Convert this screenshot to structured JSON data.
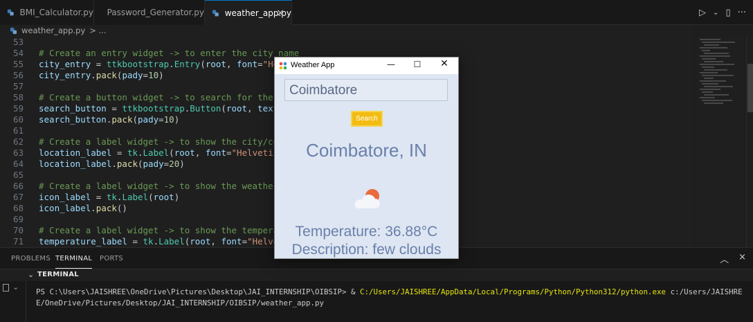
{
  "tabs": [
    {
      "label": "BMI_Calculator.py",
      "active": false
    },
    {
      "label": "Password_Generator.py",
      "active": false
    },
    {
      "label": "weather_app.py",
      "active": true
    }
  ],
  "breadcrumb": {
    "file": "weather_app.py",
    "rest": "> ..."
  },
  "editor": {
    "lines": [
      {
        "n": "53",
        "code": ""
      },
      {
        "n": "54",
        "code": "# Create an entry widget -> to enter the city name"
      },
      {
        "n": "55",
        "code": "city_entry = ttkbootstrap.Entry(root, font=\"Helvetica"
      },
      {
        "n": "56",
        "code": "city_entry.pack(pady=10)"
      },
      {
        "n": "57",
        "code": ""
      },
      {
        "n": "58",
        "code": "# Create a button widget -> to search for the weather"
      },
      {
        "n": "59",
        "code": "search_button = ttkbootstrap.Button(root, text=\"Searc"
      },
      {
        "n": "60",
        "code": "search_button.pack(pady=10)"
      },
      {
        "n": "61",
        "code": ""
      },
      {
        "n": "62",
        "code": "# Create a label widget -> to show the city/country n"
      },
      {
        "n": "63",
        "code": "location_label = tk.Label(root, font=\"Helvetica, 25\")"
      },
      {
        "n": "64",
        "code": "location_label.pack(pady=20)"
      },
      {
        "n": "65",
        "code": ""
      },
      {
        "n": "66",
        "code": "# Create a label widget -> to show the weather icon"
      },
      {
        "n": "67",
        "code": "icon_label = tk.Label(root)"
      },
      {
        "n": "68",
        "code": "icon_label.pack()"
      },
      {
        "n": "69",
        "code": ""
      },
      {
        "n": "70",
        "code": "# Create a label widget -> to show the temperature"
      },
      {
        "n": "71",
        "code": "temperature_label = tk.Label(root, font=\"Helvetica, 2"
      }
    ]
  },
  "panel": {
    "tabs": [
      "PROBLEMS",
      "TERMINAL",
      "PORTS"
    ],
    "terminal_title": "TERMINAL",
    "prompt": "PS C:\\Users\\JAISHREE\\OneDrive\\Pictures\\Desktop\\JAI_INTERNSHIP\\OIBSIP> & ",
    "exe": "C:/Users/JAISHREE/AppData/Local/Programs/Python/Python312/python.exe",
    "args": " c:/Users/JAISHREE/OneDrive/Pictures/Desktop/JAI_INTERNSHIP/OIBSIP/weather_app.py"
  },
  "weather_window": {
    "title": "Weather App",
    "city_value": "Coimbatore",
    "search_label": "Search",
    "location": "Coimbatore, IN",
    "icon": "few-clouds-icon",
    "temperature": "Temperature: 36.88°C",
    "description": "Description: few clouds"
  },
  "colors": {
    "editor_bg": "#1f1f1f",
    "comment": "#6a9955",
    "string": "#ce9178",
    "accent": "#0078d4",
    "search_button": "#f3bc12",
    "weather_text": "#6a7fab"
  }
}
